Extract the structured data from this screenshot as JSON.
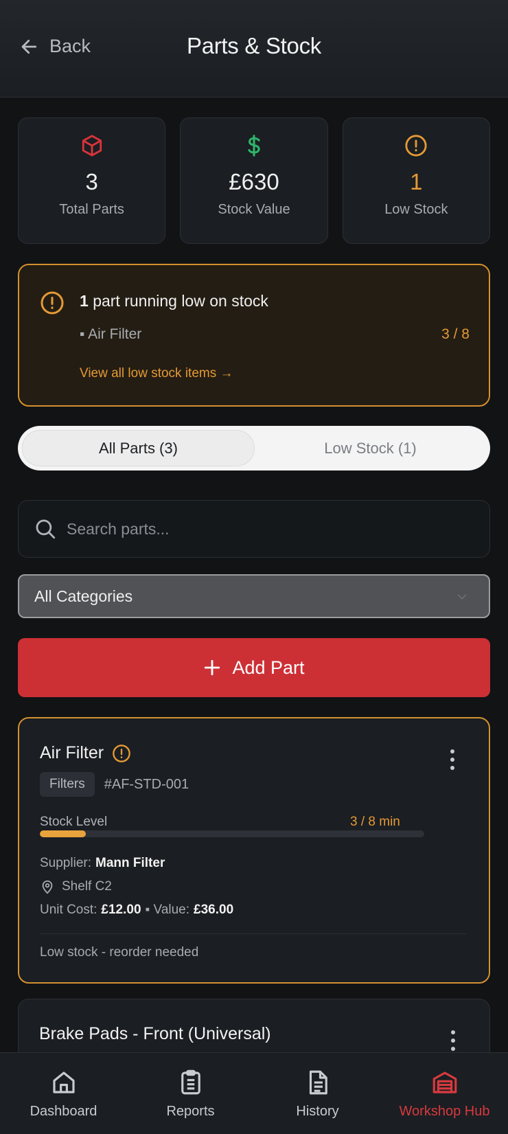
{
  "header": {
    "back_label": "Back",
    "title": "Parts & Stock"
  },
  "stats": [
    {
      "value": "3",
      "label": "Total Parts",
      "icon": "box-icon",
      "color": "#d9343a"
    },
    {
      "value": "£630",
      "label": "Stock Value",
      "icon": "dollar-icon",
      "color": "#2fb36a"
    },
    {
      "value": "1",
      "label": "Low Stock",
      "icon": "warning-circle-icon",
      "color": "#e59a35"
    }
  ],
  "alert": {
    "count": "1",
    "message": "part running low on stock",
    "item": "▪ Air Filter",
    "item_count": "3 / 8",
    "link": "View all low stock items →"
  },
  "tabs": {
    "all": "All Parts (3)",
    "low": "Low Stock (1)",
    "active": "all"
  },
  "search": {
    "placeholder": "Search parts..."
  },
  "filter": {
    "selected": "All Categories"
  },
  "add_button": {
    "label": "Add Part"
  },
  "parts": [
    {
      "name": "Air Filter",
      "category": "Filters",
      "sku": "#AF-STD-001",
      "stock_label": "Stock Level",
      "stock_text": "3 / 8 min",
      "stock_fraction": 0.12,
      "supplier_label": "Supplier:",
      "supplier": "Mann Filter",
      "location": "Shelf C2",
      "unit_cost_label": "Unit Cost:",
      "unit_cost": "£12.00",
      "value_label": "▪ Value:",
      "value": "£36.00",
      "note": "Low stock - reorder needed"
    },
    {
      "name": "Brake Pads - Front (Universal)"
    }
  ],
  "nav": [
    {
      "label": "Dashboard",
      "icon": "home-icon"
    },
    {
      "label": "Reports",
      "icon": "clipboard-icon"
    },
    {
      "label": "History",
      "icon": "document-icon"
    },
    {
      "label": "Workshop Hub",
      "icon": "garage-icon",
      "active": true
    }
  ],
  "colors": {
    "accent": "#cc3035",
    "warning": "#e59a35",
    "success": "#2fb36a",
    "background": "#111315"
  }
}
